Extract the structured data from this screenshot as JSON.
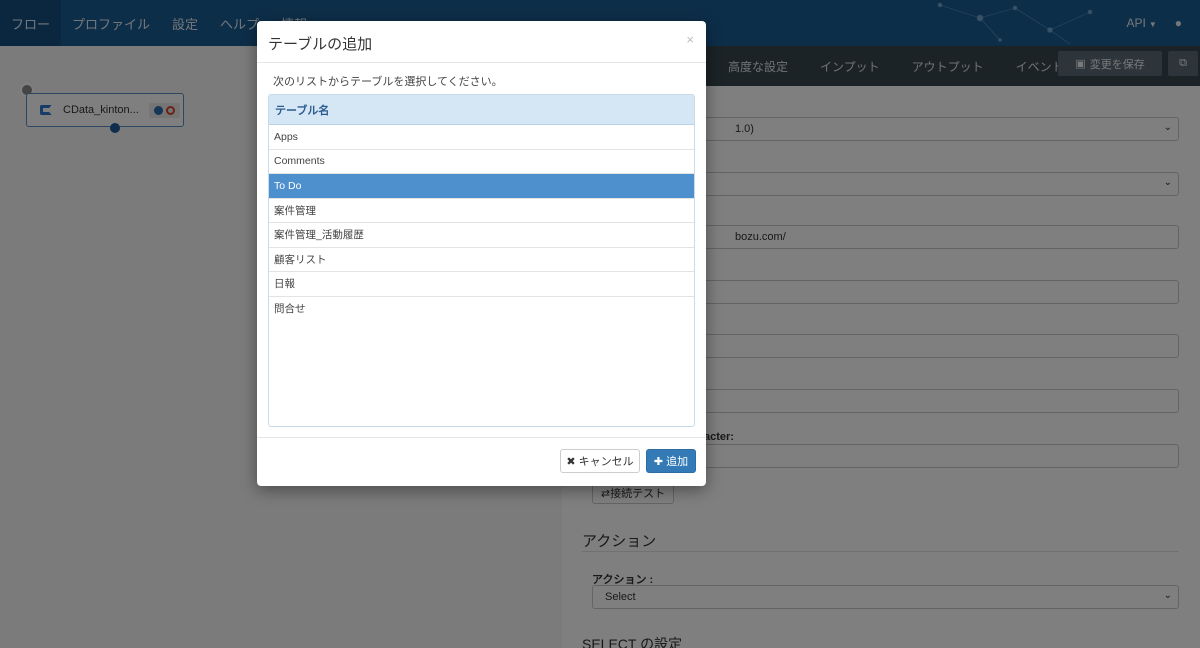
{
  "navbar": {
    "items": [
      "フロー",
      "プロファイル",
      "設定",
      "ヘルプ",
      "情報"
    ],
    "api_label": "API",
    "user_icon": "user-icon"
  },
  "canvas": {
    "connector_name": "CData_kinton..."
  },
  "panel": {
    "tabs": [
      "高度な設定",
      "インプット",
      "アウトプット",
      "イベント"
    ],
    "save_label": "変更を保存",
    "fields": {
      "version_value": "1.0)",
      "url_value": "bozu.com/",
      "char_label": "acter:",
      "test_button": "接続テスト"
    },
    "action_section": "アクション",
    "action_label": "アクション :",
    "action_select": "Select",
    "select_section": "SELECT の設定"
  },
  "modal": {
    "title": "テーブルの追加",
    "close": "×",
    "instruction": "次のリストからテーブルを選択してください。",
    "table_header": "テーブル名",
    "rows": [
      "Apps",
      "Comments",
      "To Do",
      "案件管理",
      "案件管理_活動履歴",
      "顧客リスト",
      "日報",
      "問合せ"
    ],
    "selected_row": "To Do",
    "cancel_label": "キャンセル",
    "add_label": "追加"
  },
  "colors": {
    "navbar": "#1b5c93",
    "tabbar": "#37464f",
    "selected_row": "#4e8fcd",
    "primary_button": "#337ab7"
  }
}
